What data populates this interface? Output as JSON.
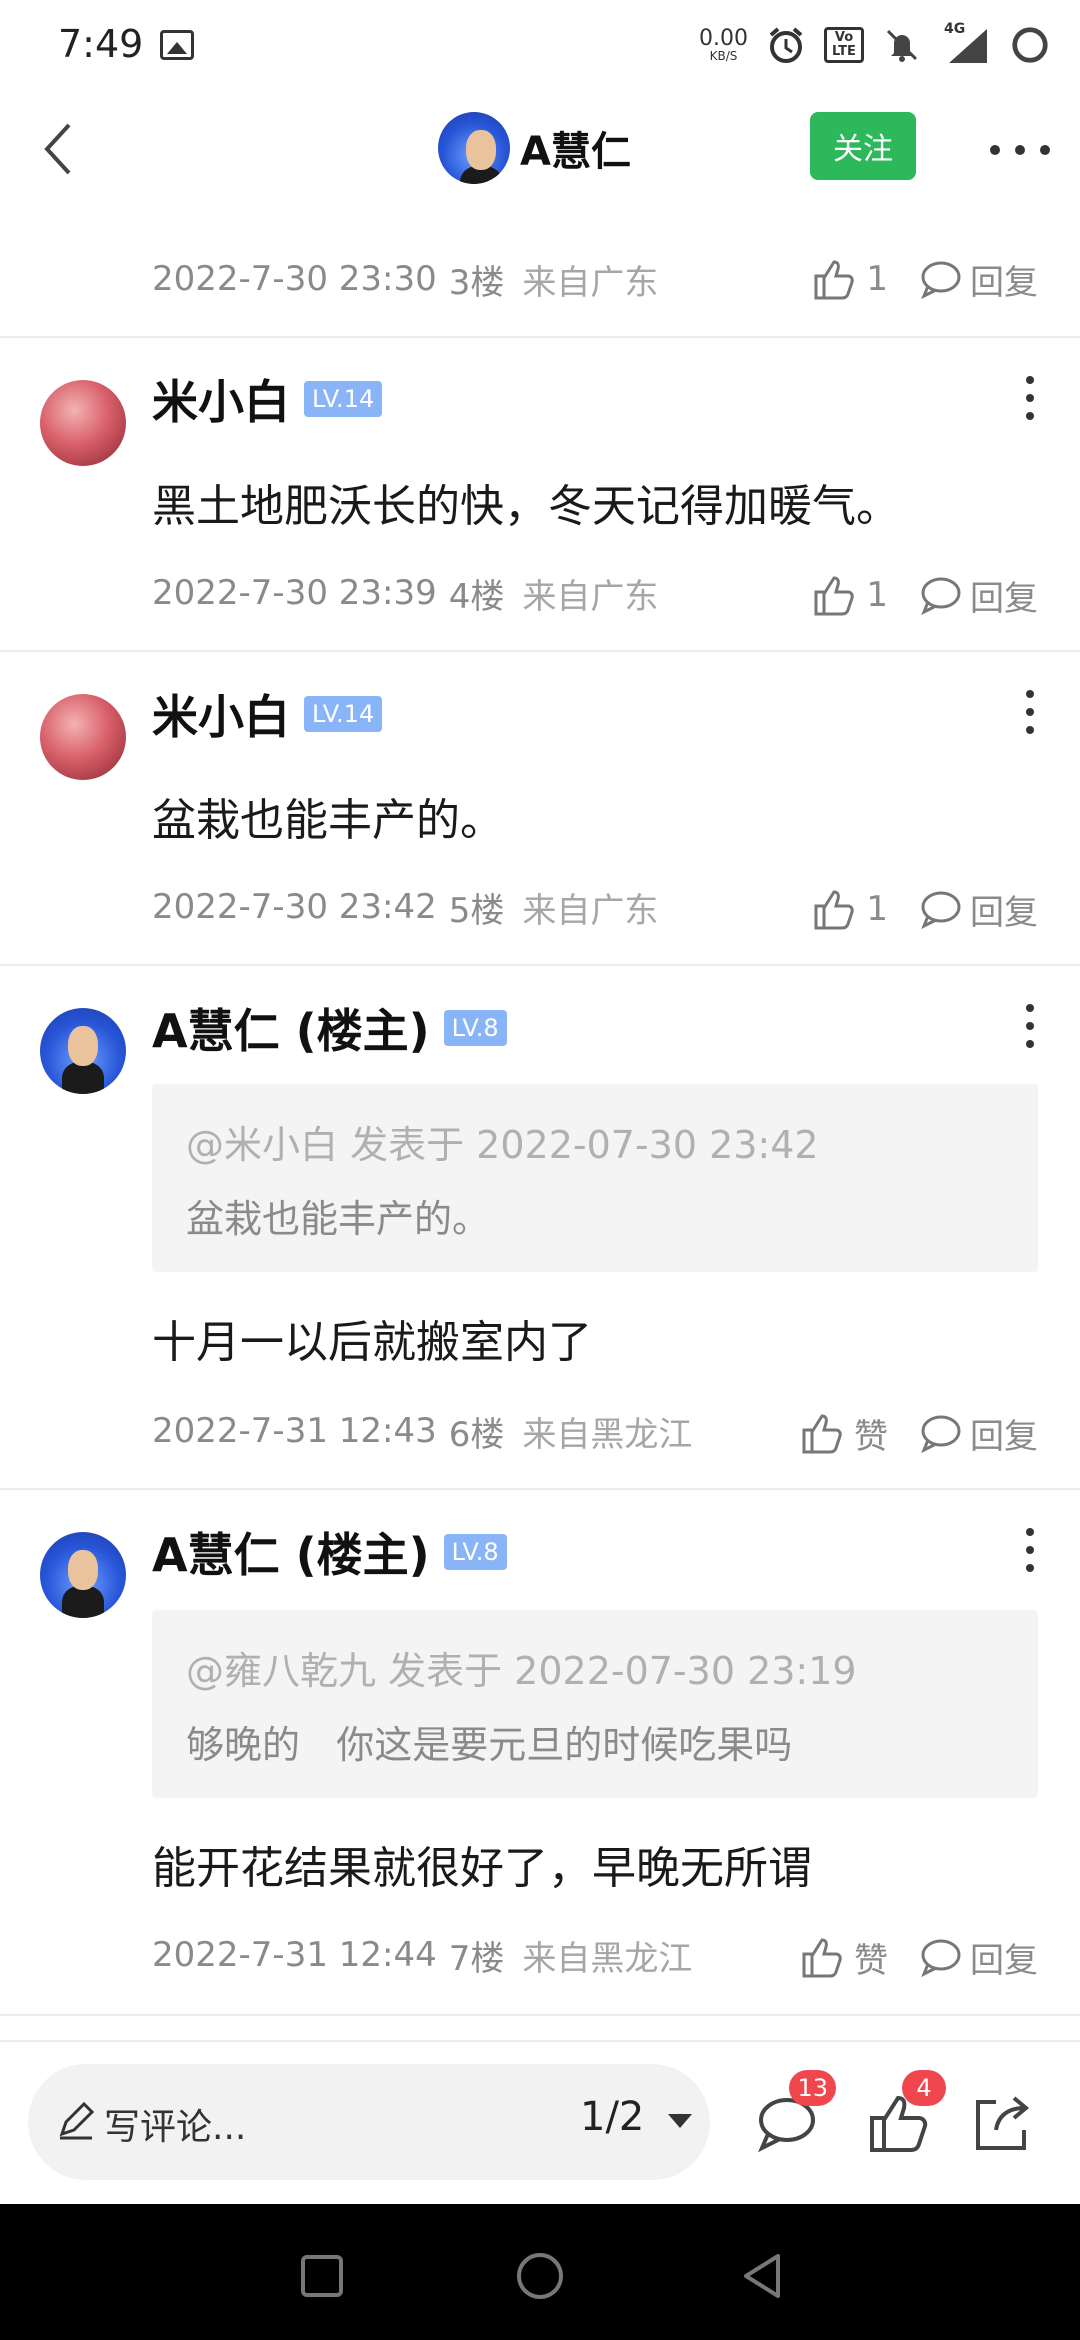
{
  "status_bar": {
    "time": "7:49",
    "speed_value": "0.00",
    "speed_unit": "KB/S",
    "network": "4G",
    "volte": "Vo LTE"
  },
  "header": {
    "back_icon": "chevron-left-icon",
    "username": "A慧仁",
    "follow_label": "关注",
    "more_icon": "more-horizontal-icon"
  },
  "floors": [
    {
      "date": "2022-7-30 23:30",
      "floor": "3楼",
      "location": "来自广东",
      "likes": "1",
      "reply_label": "回复"
    },
    {
      "user": "米小白",
      "level": "LV.14",
      "text": "黑土地肥沃长的快，冬天记得加暖气。",
      "date": "2022-7-30 23:39",
      "floor": "4楼",
      "location": "来自广东",
      "likes": "1",
      "reply_label": "回复"
    },
    {
      "user": "米小白",
      "level": "LV.14",
      "text": "盆栽也能丰产的。",
      "date": "2022-7-30 23:42",
      "floor": "5楼",
      "location": "来自广东",
      "likes": "1",
      "reply_label": "回复"
    },
    {
      "user": "A慧仁 (楼主)",
      "level": "LV.8",
      "quote_head": "@米小白 发表于 2022-07-30 23:42",
      "quote_body": "盆栽也能丰产的。",
      "text": "十月一以后就搬室内了",
      "date": "2022-7-31 12:43",
      "floor": "6楼",
      "location": "来自黑龙江",
      "likes": "赞",
      "reply_label": "回复"
    },
    {
      "user": "A慧仁 (楼主)",
      "level": "LV.8",
      "quote_head": "@雍八乾九 发表于 2022-07-30 23:19",
      "quote_body": "够晚的   你这是要元旦的时候吃果吗",
      "text": "能开花结果就很好了，早晚无所谓",
      "date": "2022-7-31 12:44",
      "floor": "7楼",
      "location": "来自黑龙江",
      "likes": "赞",
      "reply_label": "回复"
    }
  ],
  "bottom_bar": {
    "comment_placeholder": "写评论...",
    "page_indicator": "1/2",
    "comment_count": "13",
    "like_count": "4"
  },
  "colors": {
    "follow_green": "#2eb85c",
    "level_blue": "#8ab4f8",
    "badge_red": "#f0474f"
  }
}
